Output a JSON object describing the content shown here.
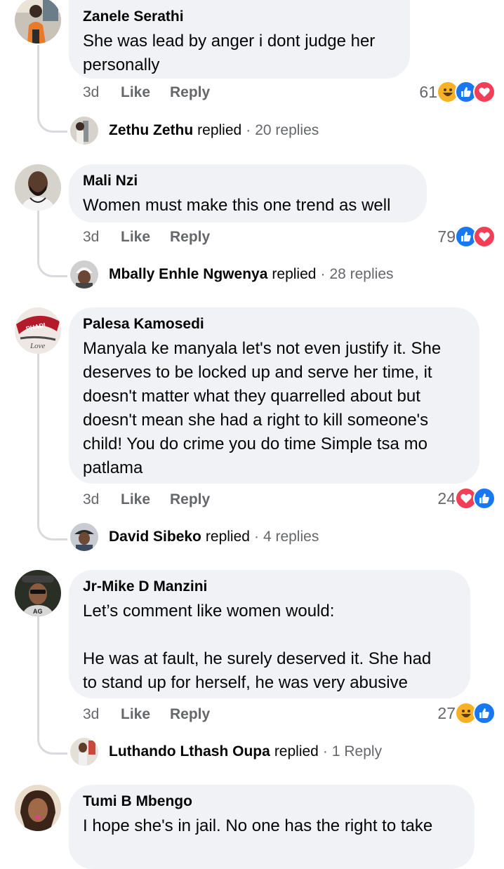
{
  "comments": [
    {
      "author": "Zanele Serathi",
      "text": "She was lead by anger i dont judge her\npersonally",
      "time": "3d",
      "like_label": "Like",
      "reply_label": "Reply",
      "reaction_count": "61",
      "reaction_icons": [
        "haha-icon",
        "like-icon",
        "love-icon"
      ],
      "replier": "Zethu Zethu",
      "replied_label": "replied",
      "reply_count": "20 replies"
    },
    {
      "author": "Mali Nzi",
      "text": "Women must make this one trend as well",
      "time": "3d",
      "like_label": "Like",
      "reply_label": "Reply",
      "reaction_count": "79",
      "reaction_icons": [
        "like-icon",
        "love-icon"
      ],
      "replier": "Mbally Enhle Ngwenya",
      "replied_label": "replied",
      "reply_count": "28 replies"
    },
    {
      "author": "Palesa Kamosedi",
      "text": "Manyala ke manyala let's not even justify it. She\ndeserves to be locked up and serve her time, it\ndoesn't matter what they quarrelled about but\ndoesn't mean she had a right to kill someone's\nchild! You do crime you do time Simple tsa mo\npatlama",
      "time": "3d",
      "like_label": "Like",
      "reply_label": "Reply",
      "reaction_count": "24",
      "reaction_icons": [
        "love-icon",
        "like-icon"
      ],
      "replier": "David Sibeko",
      "replied_label": "replied",
      "reply_count": "4 replies"
    },
    {
      "author": "Jr-Mike D Manzini",
      "text": "Let’s comment like women would:\n\nHe was at fault, he surely deserved it. She had\nto stand up for herself, he was very abusive",
      "time": "3d",
      "like_label": "Like",
      "reply_label": "Reply",
      "reaction_count": "27",
      "reaction_icons": [
        "haha-icon",
        "like-icon"
      ],
      "replier": "Luthando Lthash Oupa",
      "replied_label": "replied",
      "reply_count": "1 Reply"
    },
    {
      "author": "Tumi B Mbengo",
      "text": "I hope she's in jail. No one has the right to take"
    }
  ],
  "avatar_badge_text": "PHADI",
  "avatar_badge_script": "Love",
  "avatar_cap_text": "AG",
  "colors": {
    "bubble": "#f0f2f5",
    "meta_text": "#65676b",
    "like_blue": "#1877f2",
    "love_red": "#f33e58",
    "haha_yellow": "#f7b125",
    "connector": "#d8dade"
  }
}
